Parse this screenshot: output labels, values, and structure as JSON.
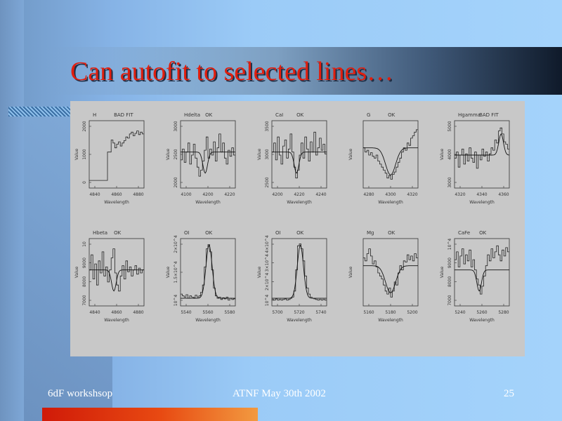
{
  "slide": {
    "title": "Can autofit to selected lines…",
    "footer_left": "6dF workshsop",
    "footer_center": "ATNF May 30th 2002",
    "footer_right": "25",
    "colors": {
      "title": "#e01e0e",
      "title_bar_dark": "#0f1a2a",
      "accent_bar": "#d01a08",
      "figure_bg": "#c8c8c8"
    }
  },
  "figure": {
    "panels": [
      {
        "title": "H",
        "status": "BAD FIT",
        "xlabel": "Wavelength",
        "ylabel": "Value",
        "xticks": [
          "4840",
          "4860",
          "4880"
        ],
        "yticks": [
          "0",
          "1000",
          "2000"
        ],
        "fit": "none",
        "y": [
          0.08,
          0.08,
          0.08,
          0.08,
          0.08,
          0.08,
          0.08,
          0.08,
          0.08,
          0.08,
          0.55,
          0.55,
          0.75,
          0.7,
          0.62,
          0.68,
          0.72,
          0.65,
          0.7,
          0.74,
          0.8,
          0.78,
          0.85,
          0.88,
          0.82,
          0.86,
          0.9,
          0.84,
          0.88,
          0.85
        ]
      },
      {
        "title": "Hdelta",
        "status": "OK",
        "xlabel": "Wavelength",
        "ylabel": "Value",
        "xticks": [
          "4100",
          "4200",
          "4220"
        ],
        "yticks": [
          "2000",
          "2500",
          "3000"
        ],
        "fit": "dip",
        "y": [
          0.42,
          0.6,
          0.38,
          0.55,
          0.7,
          0.35,
          0.5,
          0.68,
          0.45,
          0.3,
          0.15,
          0.25,
          0.4,
          0.58,
          0.8,
          0.45,
          0.6,
          0.5,
          0.72,
          0.4,
          0.62,
          0.85,
          0.55,
          0.7,
          0.45,
          0.35,
          0.58,
          0.48,
          0.62,
          0.5
        ]
      },
      {
        "title": "CaI",
        "status": "OK",
        "xlabel": "Wavelength",
        "ylabel": "Value",
        "xticks": [
          "4200",
          "4220",
          "4240"
        ],
        "yticks": [
          "2500",
          "3000",
          "3500"
        ],
        "fit": "dip",
        "y": [
          0.55,
          0.7,
          0.42,
          0.8,
          0.5,
          0.35,
          0.65,
          0.75,
          0.45,
          0.6,
          0.85,
          0.55,
          0.3,
          0.12,
          0.25,
          0.5,
          0.7,
          0.45,
          0.8,
          0.6,
          0.4,
          0.72,
          0.55,
          0.88,
          0.5,
          0.62,
          0.78,
          0.58,
          0.68,
          0.52
        ]
      },
      {
        "title": "G",
        "status": "OK",
        "xlabel": "Wavelength",
        "ylabel": "Value",
        "xticks": [
          "4280",
          "4300",
          "4320"
        ],
        "yticks": [],
        "fit": "wide",
        "y": [
          0.62,
          0.55,
          0.58,
          0.5,
          0.54,
          0.48,
          0.45,
          0.5,
          0.4,
          0.35,
          0.3,
          0.25,
          0.2,
          0.12,
          0.16,
          0.1,
          0.18,
          0.22,
          0.3,
          0.38,
          0.45,
          0.55,
          0.62,
          0.58,
          0.7,
          0.66,
          0.78,
          0.82,
          0.88,
          0.92
        ]
      },
      {
        "title": "Hgamma",
        "status": "BAD FIT",
        "xlabel": "Wavelength",
        "ylabel": "Value",
        "xticks": [
          "4320",
          "4340",
          "4360"
        ],
        "yticks": [
          "3000",
          "4000",
          "5000"
        ],
        "fit": "peak",
        "y": [
          0.45,
          0.55,
          0.3,
          0.5,
          0.6,
          0.35,
          0.52,
          0.4,
          0.62,
          0.45,
          0.38,
          0.55,
          0.28,
          0.5,
          0.42,
          0.6,
          0.48,
          0.55,
          0.4,
          0.52,
          0.62,
          0.58,
          0.75,
          0.7,
          0.9,
          0.95,
          0.85,
          0.72,
          0.68,
          0.6
        ]
      },
      {
        "title": "Hbeta",
        "status": "OK",
        "xlabel": "Wavelength",
        "ylabel": "Value",
        "xticks": [
          "4840",
          "4860",
          "4880"
        ],
        "yticks": [
          "7000",
          "8000",
          "9000",
          "10"
        ],
        "fit": "dip",
        "y": [
          0.55,
          0.8,
          0.4,
          0.65,
          0.3,
          0.7,
          0.5,
          0.85,
          0.45,
          0.6,
          0.35,
          0.55,
          0.75,
          0.9,
          0.5,
          0.3,
          0.2,
          0.45,
          0.62,
          0.4,
          0.7,
          0.52,
          0.6,
          0.45,
          0.55,
          0.62,
          0.48,
          0.58,
          0.5,
          0.55
        ]
      },
      {
        "title": "OI",
        "status": "OK",
        "xlabel": "Wavelength",
        "ylabel": "Value",
        "xticks": [
          "5540",
          "5560",
          "5580"
        ],
        "yticks": [
          "10^4",
          "1.5×10^4",
          "2×10^4"
        ],
        "fit": "tall",
        "y": [
          0.15,
          0.12,
          0.1,
          0.14,
          0.08,
          0.12,
          0.1,
          0.09,
          0.13,
          0.1,
          0.12,
          0.18,
          0.3,
          0.6,
          0.9,
          0.97,
          0.85,
          0.55,
          0.25,
          0.12,
          0.08,
          0.1,
          0.06,
          0.09,
          0.07,
          0.1,
          0.05,
          0.08,
          0.06,
          0.07
        ]
      },
      {
        "title": "OI",
        "status": "OK",
        "xlabel": "Wavelength",
        "ylabel": "Value",
        "xticks": [
          "5700",
          "5720",
          "5740"
        ],
        "yticks": [
          "10^4",
          "2×10^4",
          "3×10^4",
          "4×10^4"
        ],
        "fit": "tall",
        "y": [
          0.06,
          0.05,
          0.07,
          0.05,
          0.06,
          0.05,
          0.06,
          0.07,
          0.05,
          0.06,
          0.08,
          0.1,
          0.2,
          0.55,
          0.95,
          0.98,
          0.9,
          0.7,
          0.45,
          0.25,
          0.15,
          0.1,
          0.08,
          0.07,
          0.06,
          0.05,
          0.06,
          0.05,
          0.06,
          0.05
        ]
      },
      {
        "title": "Mg",
        "status": "OK",
        "xlabel": "Wavelength",
        "ylabel": "Value",
        "xticks": [
          "5160",
          "5180",
          "5200"
        ],
        "yticks": [],
        "fit": "wide",
        "y": [
          0.75,
          0.7,
          0.82,
          0.9,
          0.78,
          0.65,
          0.7,
          0.6,
          0.5,
          0.45,
          0.4,
          0.3,
          0.2,
          0.15,
          0.25,
          0.1,
          0.2,
          0.35,
          0.3,
          0.5,
          0.62,
          0.55,
          0.7,
          0.68,
          0.8,
          0.72,
          0.78,
          0.7,
          0.82,
          0.75
        ]
      },
      {
        "title": "CaFe",
        "status": "OK",
        "xlabel": "Wavelength",
        "ylabel": "Value",
        "xticks": [
          "5240",
          "5260",
          "5280"
        ],
        "yticks": [
          "7000",
          "8000",
          "9000",
          "10^4"
        ],
        "fit": "dip",
        "y": [
          0.72,
          0.85,
          0.6,
          0.78,
          0.9,
          0.65,
          0.8,
          0.7,
          0.88,
          0.6,
          0.72,
          0.55,
          0.4,
          0.3,
          0.15,
          0.28,
          0.45,
          0.62,
          0.8,
          0.7,
          0.9,
          0.75,
          0.85,
          0.95,
          0.8,
          0.7,
          0.88,
          0.78,
          0.92,
          0.85
        ]
      }
    ]
  }
}
